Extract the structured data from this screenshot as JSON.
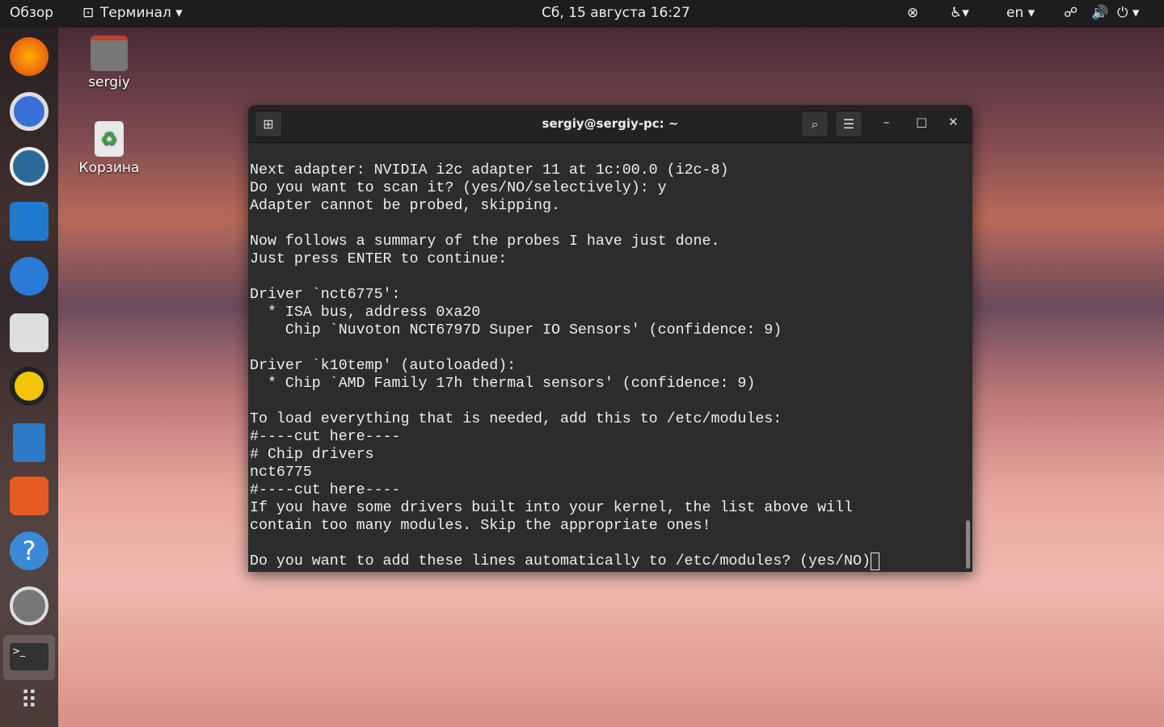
{
  "topbar": {
    "overview": "Обзор",
    "app_menu": "Терминал ▾",
    "clock": "Сб, 15 августа  16:27",
    "lang": "en ▾"
  },
  "desktop": {
    "home": "sergiy",
    "trash": "Корзина"
  },
  "terminal": {
    "title": "sergiy@sergiy-pc: ~",
    "lines": [
      "Next adapter: NVIDIA i2c adapter 11 at 1c:00.0 (i2c-8)",
      "Do you want to scan it? (yes/NO/selectively): y",
      "Adapter cannot be probed, skipping.",
      "",
      "Now follows a summary of the probes I have just done.",
      "Just press ENTER to continue:",
      "",
      "Driver `nct6775':",
      "  * ISA bus, address 0xa20",
      "    Chip `Nuvoton NCT6797D Super IO Sensors' (confidence: 9)",
      "",
      "Driver `k10temp' (autoloaded):",
      "  * Chip `AMD Family 17h thermal sensors' (confidence: 9)",
      "",
      "To load everything that is needed, add this to /etc/modules:",
      "#----cut here----",
      "# Chip drivers",
      "nct6775",
      "#----cut here----",
      "If you have some drivers built into your kernel, the list above will",
      "contain too many modules. Skip the appropriate ones!",
      ""
    ],
    "prompt": "Do you want to add these lines automatically to /etc/modules? (yes/NO)"
  }
}
